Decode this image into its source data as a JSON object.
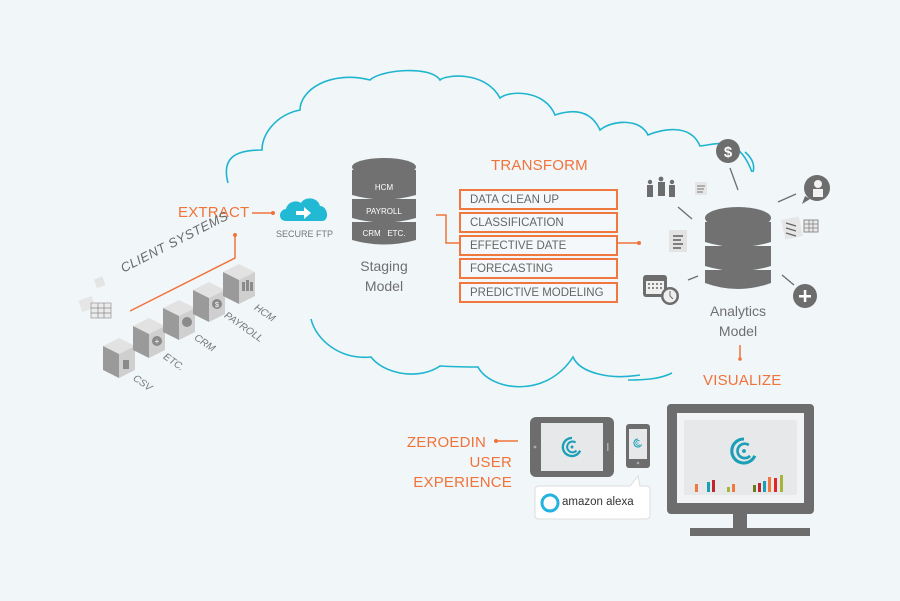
{
  "colors": {
    "background": "#f1f6f9",
    "accent_orange": "#f0733a",
    "cloud_stroke": "#1fb5cf",
    "icon_gray": "#6d6d6d",
    "ftp_cloud": "#22b9d4"
  },
  "extract": {
    "label": "EXTRACT",
    "client_systems_label": "CLIENT SYSTEMS",
    "systems": [
      {
        "label": "CSV",
        "icon": "file-icon"
      },
      {
        "label": "ETC.",
        "icon": "plus-icon"
      },
      {
        "label": "CRM",
        "icon": "headset-icon"
      },
      {
        "label": "PAYROLL",
        "icon": "dollar-icon"
      },
      {
        "label": "HCM",
        "icon": "people-icon"
      }
    ],
    "secure_ftp_label": "SECURE FTP"
  },
  "staging": {
    "db_rows": [
      "HCM",
      "PAYROLL",
      "CRM   ETC."
    ],
    "label_line1": "Staging",
    "label_line2": "Model"
  },
  "transform": {
    "label": "TRANSFORM",
    "steps": [
      "DATA CLEAN UP",
      "CLASSIFICATION",
      "EFFECTIVE DATE",
      "FORECASTING",
      "PREDICTIVE MODELING"
    ]
  },
  "analytics": {
    "label_line1": "Analytics",
    "label_line2": "Model",
    "satellites": [
      "dollar-icon",
      "people-icon",
      "document-icon",
      "person-chat-icon",
      "spreadsheet-icon",
      "calendar-clock-icon",
      "plus-icon"
    ]
  },
  "visualize": {
    "label": "VISUALIZE",
    "ux_label_line1": "ZEROEDIN",
    "ux_label_line2": "USER EXPERIENCE",
    "alexa_label": "amazon alexa"
  }
}
